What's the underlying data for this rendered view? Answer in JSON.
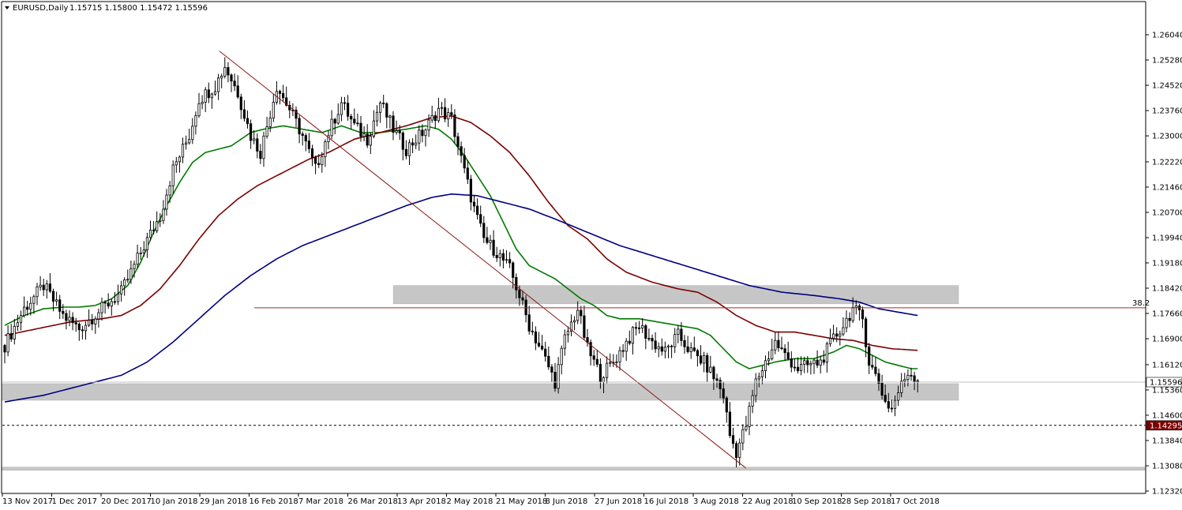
{
  "header": {
    "symbol": "EURUSD,Daily",
    "ohlc": "1.15715 1.15800 1.15472 1.15596"
  },
  "colors": {
    "background": "#ffffff",
    "candle": "#000000",
    "ma_fast": "#007a00",
    "ma_mid": "#7b0000",
    "ma_slow": "#000080",
    "zone": "#c6c6c6",
    "fib_line": "#a52a2a",
    "trendline": "#8b1a1a",
    "current_price_line": "#c0c0c0",
    "support_dashed": "#000000"
  },
  "chart_data": {
    "type": "candlestick",
    "instrument": "EURUSD",
    "timeframe": "Daily",
    "ylim": [
      1.1232,
      1.2642
    ],
    "y_ticks": [
      "1.26040",
      "1.25280",
      "1.24520",
      "1.23760",
      "1.23000",
      "1.22220",
      "1.21460",
      "1.20700",
      "1.19940",
      "1.19180",
      "1.18420",
      "1.17660",
      "1.16900",
      "1.16120",
      "1.15360",
      "1.14600",
      "1.13840",
      "1.13080",
      "1.12320"
    ],
    "x_ticks": [
      "13 Nov 2017",
      "1 Dec 2017",
      "20 Dec 2017",
      "10 Jan 2018",
      "29 Jan 2018",
      "16 Feb 2018",
      "7 Mar 2018",
      "26 Mar 2018",
      "13 Apr 2018",
      "2 May 2018",
      "21 May 2018",
      "8 Jun 2018",
      "27 Jun 2018",
      "16 Jul 2018",
      "3 Aug 2018",
      "22 Aug 2018",
      "10 Sep 2018",
      "28 Sep 2018",
      "17 Oct 2018"
    ],
    "current_price": "1.15596",
    "support_price": "1.14295",
    "fib_label": "38.2",
    "fib_level": 1.1783,
    "zones": [
      {
        "from": 1.1795,
        "to": 1.185,
        "start": "2 May 2018",
        "end": "1 Nov 2018"
      },
      {
        "from": 1.1505,
        "to": 1.1555,
        "start": "13 Nov 2017",
        "end": "1 Nov 2018"
      },
      {
        "from": 1.1298,
        "to": 1.1304,
        "start": "13 Nov 2017",
        "end": "right edge"
      }
    ],
    "trendline": {
      "from": {
        "date": "16 Feb 2018",
        "price": 1.2555
      },
      "to": {
        "date": "15 Aug 2018",
        "price": 1.1301
      }
    },
    "price_path": [
      [
        0,
        1.167
      ],
      [
        6,
        1.178
      ],
      [
        12,
        1.185
      ],
      [
        18,
        1.176
      ],
      [
        23,
        1.172
      ],
      [
        30,
        1.178
      ],
      [
        36,
        1.183
      ],
      [
        42,
        1.195
      ],
      [
        48,
        1.206
      ],
      [
        52,
        1.22
      ],
      [
        57,
        1.23
      ],
      [
        60,
        1.241
      ],
      [
        65,
        1.245
      ],
      [
        68,
        1.251
      ],
      [
        72,
        1.243
      ],
      [
        76,
        1.23
      ],
      [
        79,
        1.225
      ],
      [
        84,
        1.245
      ],
      [
        88,
        1.238
      ],
      [
        92,
        1.23
      ],
      [
        96,
        1.22
      ],
      [
        100,
        1.231
      ],
      [
        104,
        1.24
      ],
      [
        108,
        1.233
      ],
      [
        112,
        1.229
      ],
      [
        116,
        1.24
      ],
      [
        120,
        1.232
      ],
      [
        124,
        1.226
      ],
      [
        130,
        1.232
      ],
      [
        134,
        1.238
      ],
      [
        138,
        1.235
      ],
      [
        141,
        1.223
      ],
      [
        145,
        1.208
      ],
      [
        148,
        1.199
      ],
      [
        152,
        1.195
      ],
      [
        156,
        1.19
      ],
      [
        159,
        1.182
      ],
      [
        162,
        1.173
      ],
      [
        166,
        1.165
      ],
      [
        170,
        1.156
      ],
      [
        173,
        1.169
      ],
      [
        177,
        1.178
      ],
      [
        180,
        1.166
      ],
      [
        184,
        1.158
      ],
      [
        188,
        1.162
      ],
      [
        192,
        1.168
      ],
      [
        196,
        1.173
      ],
      [
        200,
        1.168
      ],
      [
        204,
        1.165
      ],
      [
        208,
        1.17
      ],
      [
        212,
        1.165
      ],
      [
        216,
        1.162
      ],
      [
        220,
        1.156
      ],
      [
        222,
        1.152
      ],
      [
        224,
        1.14
      ],
      [
        226,
        1.135
      ],
      [
        229,
        1.143
      ],
      [
        232,
        1.156
      ],
      [
        235,
        1.162
      ],
      [
        238,
        1.168
      ],
      [
        241,
        1.164
      ],
      [
        245,
        1.16
      ],
      [
        248,
        1.161
      ],
      [
        252,
        1.162
      ],
      [
        256,
        1.169
      ],
      [
        259,
        1.173
      ],
      [
        262,
        1.178
      ],
      [
        265,
        1.175
      ],
      [
        267,
        1.162
      ],
      [
        270,
        1.156
      ],
      [
        272,
        1.15
      ],
      [
        274,
        1.148
      ],
      [
        276,
        1.153
      ],
      [
        279,
        1.159
      ],
      [
        282,
        1.157
      ]
    ],
    "series": [
      {
        "name": "",
        "type": "ma",
        "color": "#007a00",
        "points": [
          [
            0,
            1.173
          ],
          [
            6,
            1.176
          ],
          [
            12,
            1.178
          ],
          [
            18,
            1.1785
          ],
          [
            23,
            1.1785
          ],
          [
            28,
            1.179
          ],
          [
            33,
            1.181
          ],
          [
            38,
            1.185
          ],
          [
            42,
            1.192
          ],
          [
            46,
            1.201
          ],
          [
            50,
            1.209
          ],
          [
            54,
            1.216
          ],
          [
            58,
            1.222
          ],
          [
            62,
            1.225
          ],
          [
            66,
            1.226
          ],
          [
            70,
            1.227
          ],
          [
            76,
            1.231
          ],
          [
            80,
            1.232
          ],
          [
            86,
            1.233
          ],
          [
            92,
            1.232
          ],
          [
            98,
            1.231
          ],
          [
            104,
            1.233
          ],
          [
            110,
            1.231
          ],
          [
            116,
            1.231
          ],
          [
            124,
            1.232
          ],
          [
            130,
            1.233
          ],
          [
            134,
            1.232
          ],
          [
            138,
            1.229
          ],
          [
            142,
            1.224
          ],
          [
            146,
            1.218
          ],
          [
            150,
            1.212
          ],
          [
            154,
            1.204
          ],
          [
            158,
            1.196
          ],
          [
            162,
            1.191
          ],
          [
            166,
            1.189
          ],
          [
            170,
            1.187
          ],
          [
            174,
            1.184
          ],
          [
            178,
            1.181
          ],
          [
            182,
            1.179
          ],
          [
            186,
            1.176
          ],
          [
            190,
            1.175
          ],
          [
            196,
            1.175
          ],
          [
            202,
            1.174
          ],
          [
            208,
            1.173
          ],
          [
            214,
            1.172
          ],
          [
            218,
            1.17
          ],
          [
            222,
            1.166
          ],
          [
            226,
            1.162
          ],
          [
            230,
            1.16
          ],
          [
            234,
            1.161
          ],
          [
            238,
            1.162
          ],
          [
            244,
            1.163
          ],
          [
            250,
            1.163
          ],
          [
            256,
            1.165
          ],
          [
            260,
            1.167
          ],
          [
            264,
            1.166
          ],
          [
            268,
            1.164
          ],
          [
            272,
            1.162
          ],
          [
            276,
            1.161
          ],
          [
            280,
            1.16
          ],
          [
            282,
            1.16
          ]
        ]
      },
      {
        "name": "",
        "type": "ma",
        "color": "#7b0000",
        "points": [
          [
            0,
            1.17
          ],
          [
            10,
            1.172
          ],
          [
            20,
            1.174
          ],
          [
            30,
            1.175
          ],
          [
            36,
            1.176
          ],
          [
            42,
            1.179
          ],
          [
            48,
            1.184
          ],
          [
            54,
            1.191
          ],
          [
            60,
            1.199
          ],
          [
            66,
            1.206
          ],
          [
            72,
            1.211
          ],
          [
            78,
            1.215
          ],
          [
            86,
            1.219
          ],
          [
            94,
            1.223
          ],
          [
            100,
            1.225
          ],
          [
            108,
            1.229
          ],
          [
            116,
            1.231
          ],
          [
            124,
            1.233
          ],
          [
            132,
            1.2355
          ],
          [
            138,
            1.236
          ],
          [
            144,
            1.234
          ],
          [
            150,
            1.23
          ],
          [
            156,
            1.225
          ],
          [
            162,
            1.218
          ],
          [
            168,
            1.21
          ],
          [
            174,
            1.203
          ],
          [
            180,
            1.199
          ],
          [
            186,
            1.193
          ],
          [
            192,
            1.189
          ],
          [
            200,
            1.186
          ],
          [
            208,
            1.184
          ],
          [
            214,
            1.183
          ],
          [
            220,
            1.18
          ],
          [
            226,
            1.176
          ],
          [
            232,
            1.173
          ],
          [
            238,
            1.171
          ],
          [
            244,
            1.171
          ],
          [
            250,
            1.17
          ],
          [
            256,
            1.169
          ],
          [
            262,
            1.1685
          ],
          [
            268,
            1.167
          ],
          [
            274,
            1.166
          ],
          [
            282,
            1.1655
          ]
        ]
      },
      {
        "name": "",
        "type": "ma",
        "color": "#000080",
        "points": [
          [
            0,
            1.15
          ],
          [
            12,
            1.152
          ],
          [
            24,
            1.155
          ],
          [
            36,
            1.158
          ],
          [
            44,
            1.162
          ],
          [
            52,
            1.168
          ],
          [
            60,
            1.175
          ],
          [
            68,
            1.182
          ],
          [
            76,
            1.188
          ],
          [
            84,
            1.193
          ],
          [
            92,
            1.197
          ],
          [
            100,
            1.2
          ],
          [
            108,
            1.203
          ],
          [
            116,
            1.206
          ],
          [
            124,
            1.209
          ],
          [
            132,
            1.2115
          ],
          [
            138,
            1.2125
          ],
          [
            146,
            1.212
          ],
          [
            154,
            1.21
          ],
          [
            162,
            1.208
          ],
          [
            170,
            1.205
          ],
          [
            180,
            1.201
          ],
          [
            190,
            1.197
          ],
          [
            200,
            1.194
          ],
          [
            210,
            1.191
          ],
          [
            220,
            1.188
          ],
          [
            230,
            1.185
          ],
          [
            240,
            1.183
          ],
          [
            250,
            1.182
          ],
          [
            258,
            1.181
          ],
          [
            264,
            1.18
          ],
          [
            270,
            1.178
          ],
          [
            276,
            1.177
          ],
          [
            282,
            1.176
          ]
        ]
      }
    ]
  }
}
